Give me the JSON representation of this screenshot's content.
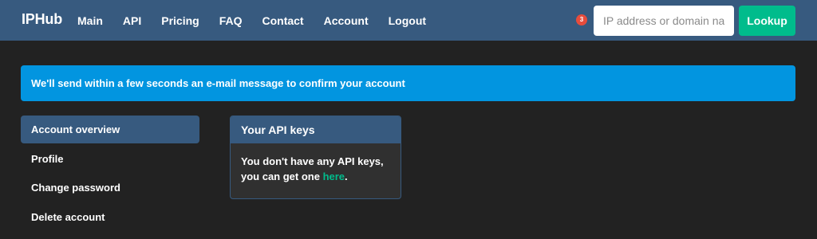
{
  "navbar": {
    "brand": "IPHub",
    "links": [
      {
        "label": "Main"
      },
      {
        "label": "API"
      },
      {
        "label": "Pricing"
      },
      {
        "label": "FAQ"
      },
      {
        "label": "Contact"
      },
      {
        "label": "Account"
      },
      {
        "label": "Logout"
      }
    ],
    "badge_count": "3",
    "search_placeholder": "IP address or domain name",
    "lookup_label": "Lookup"
  },
  "alert": {
    "text": "We'll send within a few seconds an e-mail message to confirm your account"
  },
  "sidebar": {
    "items": [
      {
        "label": "Account overview",
        "active": true
      },
      {
        "label": "Profile"
      },
      {
        "label": "Change password"
      },
      {
        "label": "Delete account"
      }
    ]
  },
  "api_panel": {
    "title": "Your API keys",
    "body_text": "You don't have any API keys, you can get one ",
    "link_text": "here",
    "body_suffix": "."
  },
  "colors": {
    "navbar": "#375a7f",
    "background": "#222222",
    "accent": "#00bc8c",
    "alert": "#0295e0",
    "badge": "#e74c3c"
  }
}
